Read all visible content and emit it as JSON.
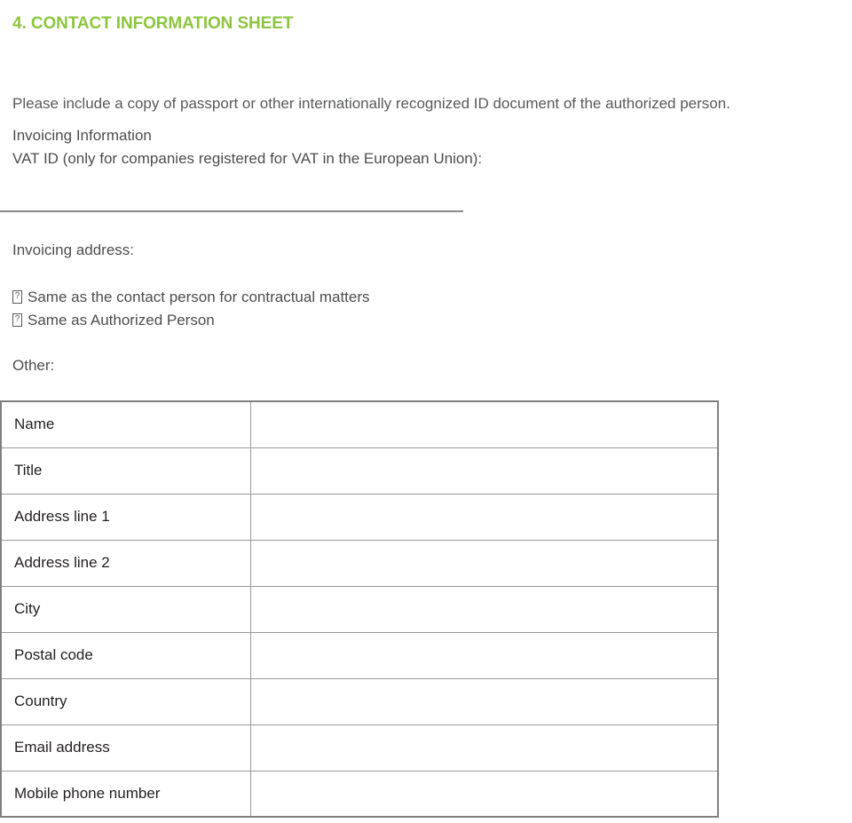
{
  "document": {
    "section_number_title": "4. CONTACT INFORMATION SHEET",
    "accent_color": "#8CC63F",
    "body_text_color": "#4D4D4D",
    "table_text_color": "#231F20",
    "table_border_color": "#808080"
  },
  "intro": {
    "text": "Please include a copy of passport or other internationally recognized ID document of the authorized person."
  },
  "invoicing": {
    "heading": "Invoicing Information",
    "vat_label": "VAT ID (only for companies registered for VAT in the European Union):",
    "vat_fill_line": "",
    "address_label": "Invoicing address:",
    "options": [
      {
        "checkbox_glyph": "checkbox-missing-glyph",
        "label": "Same as the contact person for contractual matters",
        "checked": false
      },
      {
        "checkbox_glyph": "checkbox-missing-glyph",
        "label": "Same as Authorized Person",
        "checked": false
      }
    ],
    "other_label": "Other:"
  },
  "form_table": {
    "rows": [
      {
        "label": "Name",
        "value": ""
      },
      {
        "label": "Title",
        "value": ""
      },
      {
        "label": "Address line 1",
        "value": ""
      },
      {
        "label": "Address line 2",
        "value": ""
      },
      {
        "label": "City",
        "value": ""
      },
      {
        "label": "Postal code",
        "value": ""
      },
      {
        "label": "Country",
        "value": ""
      },
      {
        "label": "Email address",
        "value": ""
      },
      {
        "label": "Mobile phone number",
        "value": ""
      }
    ]
  }
}
